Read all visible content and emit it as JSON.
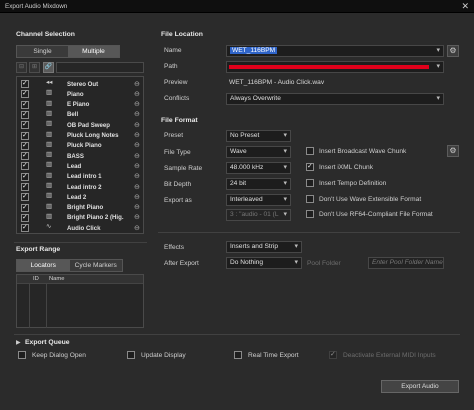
{
  "window": {
    "title": "Export Audio Mixdown",
    "close_glyph": "✕"
  },
  "channel_selection": {
    "title": "Channel Selection",
    "tabs": [
      "Single",
      "Multiple"
    ],
    "active_tab": "Multiple",
    "channels": [
      {
        "name": "Stereo Out",
        "icon": "speaker-icon",
        "glyph": "◂◂",
        "checked": true
      },
      {
        "name": "Piano",
        "icon": "piano-icon",
        "glyph": "▥",
        "checked": true
      },
      {
        "name": "E Piano",
        "icon": "piano-icon",
        "glyph": "▥",
        "checked": true
      },
      {
        "name": "Bell",
        "icon": "piano-icon",
        "glyph": "▥",
        "checked": true
      },
      {
        "name": "OB Pad Sweep",
        "icon": "piano-icon",
        "glyph": "▥",
        "checked": true
      },
      {
        "name": "Pluck Long Notes",
        "icon": "piano-icon",
        "glyph": "▥",
        "checked": true
      },
      {
        "name": "Pluck Piano",
        "icon": "piano-icon",
        "glyph": "▥",
        "checked": true
      },
      {
        "name": "BASS",
        "icon": "piano-icon",
        "glyph": "▥",
        "checked": true
      },
      {
        "name": "Lead",
        "icon": "piano-icon",
        "glyph": "▥",
        "checked": true
      },
      {
        "name": "Lead intro 1",
        "icon": "piano-icon",
        "glyph": "▥",
        "checked": true
      },
      {
        "name": "Lead intro 2",
        "icon": "piano-icon",
        "glyph": "▥",
        "checked": true
      },
      {
        "name": "Lead 2",
        "icon": "piano-icon",
        "glyph": "▥",
        "checked": true
      },
      {
        "name": "Bright Piano",
        "icon": "piano-icon",
        "glyph": "▥",
        "checked": true
      },
      {
        "name": "Bright Piano 2 (Hig.",
        "icon": "piano-icon",
        "glyph": "▥",
        "checked": true
      },
      {
        "name": "Audio Click",
        "icon": "waveform-icon",
        "glyph": "∿",
        "checked": true
      }
    ]
  },
  "export_range": {
    "title": "Export Range",
    "tabs": [
      "Locators",
      "Cycle Markers"
    ],
    "active_tab": "Locators",
    "columns": [
      "ID",
      "Name"
    ]
  },
  "file_location": {
    "title": "File Location",
    "name_label": "Name",
    "name_value": "WET_116BPM",
    "path_label": "Path",
    "preview_label": "Preview",
    "preview_value": "WET_116BPM - Audio Click.wav",
    "conflicts_label": "Conflicts",
    "conflicts_value": "Always Overwrite"
  },
  "file_format": {
    "title": "File Format",
    "preset_label": "Preset",
    "preset_value": "No Preset",
    "file_type_label": "File Type",
    "file_type_value": "Wave",
    "sample_rate_label": "Sample Rate",
    "sample_rate_value": "48.000 kHz",
    "bit_depth_label": "Bit Depth",
    "bit_depth_value": "24 bit",
    "export_as_label": "Export as",
    "export_as_value": "Interleaved",
    "channel_pattern_value": "3 : \"audio - 01 (L",
    "options": [
      {
        "label": "Insert Broadcast Wave Chunk",
        "checked": false
      },
      {
        "label": "Insert iXML Chunk",
        "checked": true
      },
      {
        "label": "Insert Tempo Definition",
        "checked": false
      },
      {
        "label": "Don't Use Wave Extensible Format",
        "checked": false
      },
      {
        "label": "Don't Use RF64-Compliant File Format",
        "checked": false
      }
    ]
  },
  "post": {
    "effects_label": "Effects",
    "effects_value": "Inserts and Strip",
    "after_export_label": "After Export",
    "after_export_value": "Do Nothing",
    "pool_folder_label": "Pool Folder",
    "pool_folder_placeholder": "Enter Pool Folder Name"
  },
  "export_queue": {
    "title": "Export Queue",
    "keep_open": "Keep Dialog Open",
    "update_display": "Update Display",
    "real_time": "Real Time Export",
    "deactivate_midi": "Deactivate External MIDI Inputs"
  },
  "export_button": "Export Audio",
  "colors": {
    "accent": "#2f64c8",
    "path_red": "#e0001b"
  }
}
